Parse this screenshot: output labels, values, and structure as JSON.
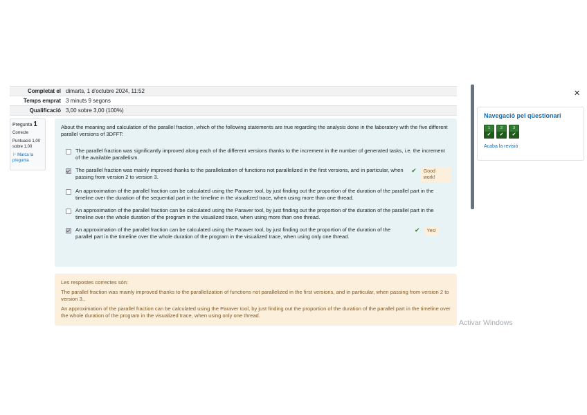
{
  "summary": [
    {
      "label": "Completat el",
      "value": "dimarts, 1 d'octubre 2024, 11:52"
    },
    {
      "label": "Temps emprat",
      "value": "3 minuts 9 segons"
    },
    {
      "label": "Qualificació",
      "value": "3,00 sobre 3,00 (100%)"
    }
  ],
  "question_info": {
    "label": "Pregunta",
    "number": "1",
    "state": "Correcte",
    "grade": "Puntuació 1,00 sobre 1,00",
    "flag": "Marca la pregunta"
  },
  "question": {
    "text": "About the meaning and calculation of the parallel fraction, which of the following statements are true regarding the analysis done in the laboratory with the five different parallel versions of 3DFFT:",
    "options": [
      {
        "text": "The parallel fraction was significantly improved along each of the different versions thanks to the increment in the number of generated tasks, i.e. the increment of the available parallelism.",
        "checked": false,
        "feedback": ""
      },
      {
        "text": "The parallel fraction was mainly improved thanks to the parallelization of functions not parallelized in the first versions, and in particular, when passing from version 2 to version 3.",
        "checked": true,
        "feedback": "Good work!"
      },
      {
        "text": "An approximation of the parallel fraction can be calculated using the Paraver tool, by just finding out the proportion of the duration of the parallel part in the timeline over the duration of the sequential part in the timeline in the visualized trace, when using more than one thread.",
        "checked": false,
        "feedback": ""
      },
      {
        "text": "An approximation of the parallel fraction can be calculated using the Paraver tool, by just finding out the proportion of the duration of the parallel part in the timeline over the whole duration of the program in the visualized trace, when using more than one thread.",
        "checked": false,
        "feedback": ""
      },
      {
        "text": "An approximation of the parallel fraction can be calculated using the Paraver tool, by just finding out the proportion of the duration of the parallel part in the timeline over the whole duration of the program in the visualized trace, when using only one thread.",
        "checked": true,
        "feedback": "Yes!"
      }
    ]
  },
  "right_answer": {
    "heading": "Les respostes correctes són:",
    "answers": [
      "The parallel fraction was mainly improved thanks to the parallelization of functions not parallelized in the first versions, and in particular, when passing from version 2 to version 3.,",
      "An approximation of the parallel fraction can be calculated using the Paraver tool, by just finding out the proportion of the duration of the parallel part in the timeline over the whole duration of the program in the visualized trace, when using only one thread."
    ]
  },
  "drawer": {
    "close_icon": "close-icon",
    "nav_title": "Navegació pel qüestionari",
    "buttons": [
      {
        "number": "1",
        "state": "correct"
      },
      {
        "number": "2",
        "state": "correct"
      },
      {
        "number": "3",
        "state": "correct"
      }
    ],
    "finish_review": "Acaba la revisió"
  },
  "watermark": "Activar Windows",
  "colors": {
    "formulation_bg": "#e7f3f5",
    "outcome_bg": "#fcefdc",
    "correct": "#357a32",
    "link": "#0f6cbf"
  }
}
